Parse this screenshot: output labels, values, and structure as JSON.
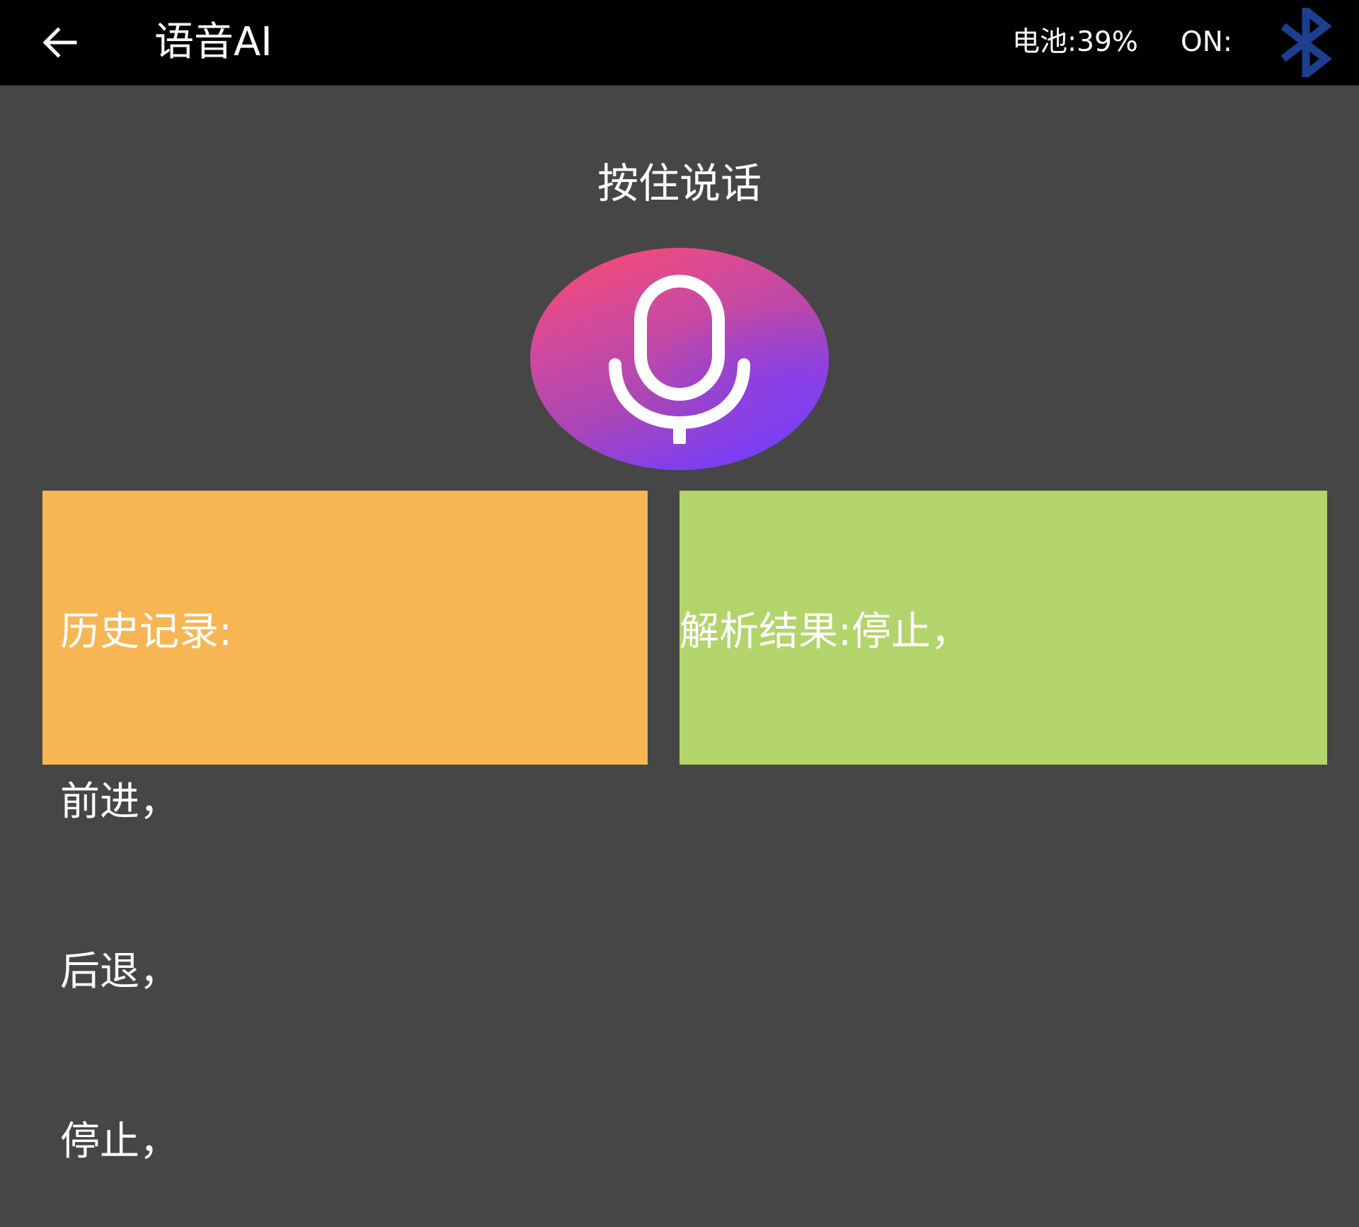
{
  "header": {
    "title": "语音AI",
    "battery_text": "电池:39%",
    "connection_text": "ON:",
    "back_icon": "arrow-left-icon",
    "bluetooth_icon": "bluetooth-icon",
    "bluetooth_color": "#1e3f8f"
  },
  "main": {
    "hint": "按住说话",
    "mic_icon": "microphone-icon",
    "mic_gradient": [
      "#ff4a6a",
      "#6f3df5"
    ]
  },
  "history": {
    "label": "历史记录:",
    "items": [
      "前进，",
      "后退，",
      "停止，"
    ],
    "color": "#f7b653"
  },
  "result": {
    "text": "解析结果:停止，",
    "color": "#b3d46b"
  }
}
